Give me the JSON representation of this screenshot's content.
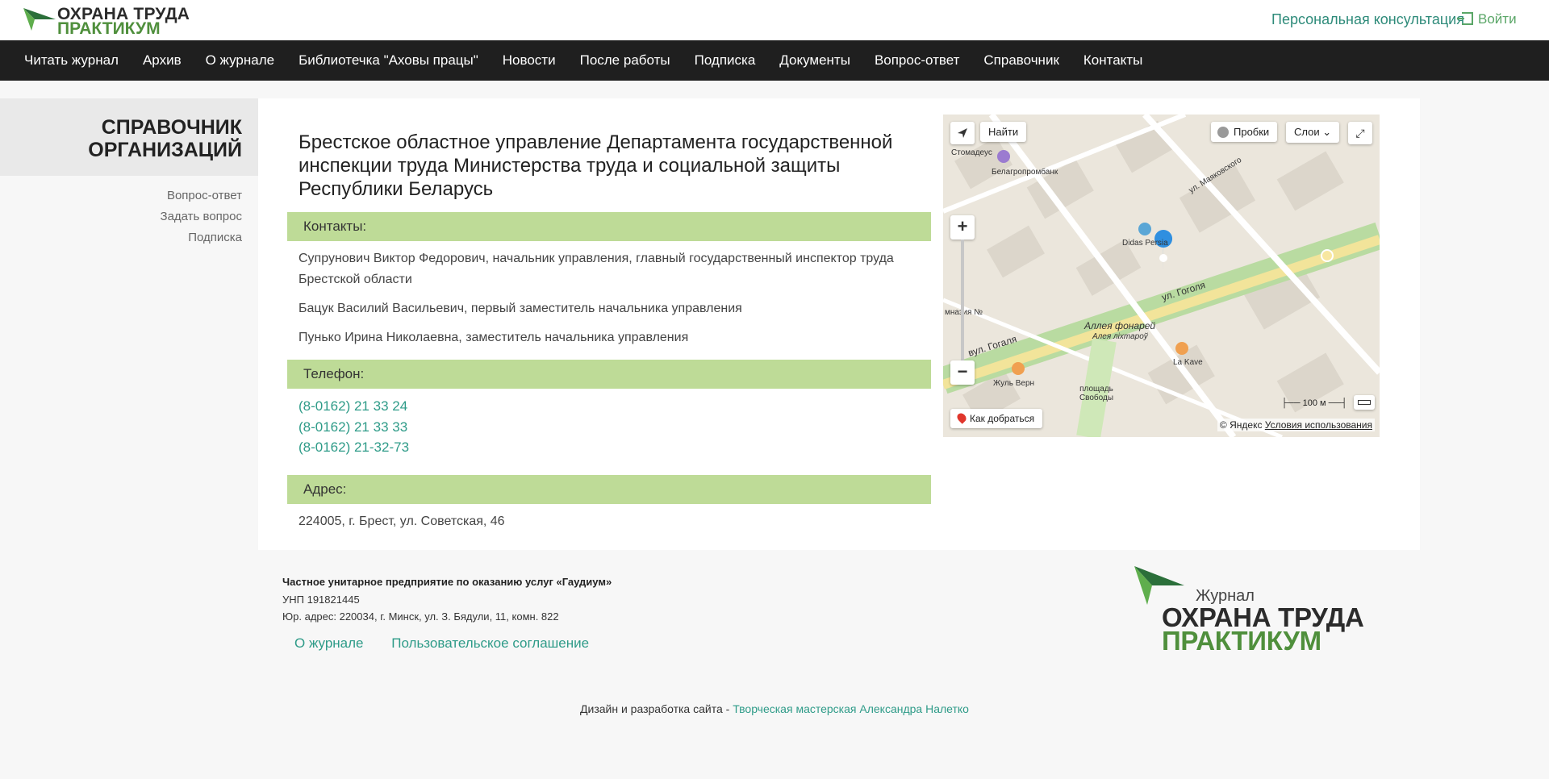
{
  "header": {
    "logo_line1": "ОХРАНА ТРУДА",
    "logo_line2": "ПРАКТИКУМ",
    "consult": "Персональная консультация",
    "login": "Войти"
  },
  "nav": {
    "items": [
      "Читать журнал",
      "Архив",
      "О журнале",
      "Библиотечка \"Аховы працы\"",
      "Новости",
      "После работы",
      "Подписка",
      "Документы",
      "Вопрос-ответ",
      "Справочник",
      "Контакты"
    ]
  },
  "sidebar": {
    "title_line1": "СПРАВОЧНИК",
    "title_line2": "ОРГАНИЗАЦИЙ",
    "links": [
      "Вопрос-ответ",
      "Задать вопрос",
      "Подписка"
    ]
  },
  "org": {
    "title": "Брестское областное управление Департамента государственной инспекции труда Министерства труда и социальной защиты Республики Беларусь",
    "contacts_heading": "Контакты:",
    "contacts": [
      "Супрунович Виктор Федорович, начальник управления, главный государственный инспектор труда Брестской области",
      "Бацук Василий Васильевич, первый заместитель начальника управления",
      "Пунько Ирина Николаевна, заместитель начальника управления"
    ],
    "phone_heading": "Телефон:",
    "phones": [
      "(8-0162) 21 33 24",
      "(8-0162) 21 33 33",
      "(8-0162) 21-32-73"
    ],
    "address_heading": "Адрес:",
    "address": "224005, г. Брест, ул. Советская, 46"
  },
  "map": {
    "find": "Найти",
    "traffic": "Пробки",
    "layers": "Слои",
    "route": "Как добраться",
    "scale": "100 м",
    "copyright": "© Яндекс",
    "terms": "Условия использования",
    "labels": [
      "Стомадеус",
      "Белагропромбанк",
      "ул. Маяковского",
      "Didas Persia",
      "ул. Гоголя",
      "вул. Гогаля",
      "Аллея фонарей",
      "Алея ліхтароў",
      "La Kave",
      "Жуль Верн",
      "площадь Свободы",
      "мназия №"
    ]
  },
  "footer": {
    "company": "Частное унитарное предприятие по оказанию услуг «Гаудиум»",
    "unp": "УНП 191821445",
    "address": "Юр. адрес: 220034, г. Минск, ул. З. Бядули, 11, комн. 822",
    "links": [
      "О журнале",
      "Пользовательское соглашение"
    ],
    "credits_prefix": "Дизайн и разработка сайта -",
    "credits_link": "Творческая мастерская Александра Налетко",
    "logo_small": "Журнал",
    "logo_line1": "ОХРАНА ТРУДА",
    "logo_line2": "ПРАКТИКУМ"
  },
  "colors": {
    "accent": "#2e9b88",
    "section_bg": "#bedb97",
    "nav_bg": "#1f1f1f"
  }
}
